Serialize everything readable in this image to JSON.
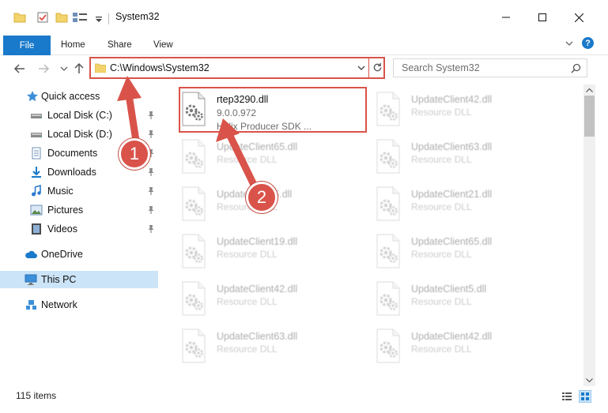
{
  "window": {
    "title": "System32"
  },
  "ribbon": {
    "file": "File",
    "home": "Home",
    "share": "Share",
    "view": "View",
    "help": "?"
  },
  "address": {
    "path": "C:\\Windows\\System32"
  },
  "search": {
    "placeholder": "Search System32"
  },
  "sidebar": {
    "items": [
      {
        "label": "Quick access",
        "icon": "star-icon",
        "pinned": false
      },
      {
        "label": "Local Disk (C:)",
        "icon": "drive-icon",
        "pinned": true
      },
      {
        "label": "Local Disk (D:)",
        "icon": "drive-icon",
        "pinned": true
      },
      {
        "label": "Documents",
        "icon": "documents-icon",
        "pinned": true
      },
      {
        "label": "Downloads",
        "icon": "downloads-icon",
        "pinned": true
      },
      {
        "label": "Music",
        "icon": "music-icon",
        "pinned": true
      },
      {
        "label": "Pictures",
        "icon": "pictures-icon",
        "pinned": true
      },
      {
        "label": "Videos",
        "icon": "videos-icon",
        "pinned": true
      },
      {
        "label": "OneDrive",
        "icon": "cloud-icon",
        "pinned": false
      },
      {
        "label": "This PC",
        "icon": "computer-icon",
        "pinned": false,
        "selected": true
      },
      {
        "label": "Network",
        "icon": "network-icon",
        "pinned": false
      }
    ]
  },
  "files": [
    {
      "name": "rtep3290.dll",
      "line2": "9.0.0.972",
      "line3": "Helix Producer SDK ...",
      "highlighted": true
    },
    {
      "name": "UpdateClient42.dll",
      "line2": "Resource DLL"
    },
    {
      "name": "UpdateClient65.dll",
      "line2": "Resource DLL"
    },
    {
      "name": "UpdateClient63.dll",
      "line2": "Resource DLL"
    },
    {
      "name": "UpdateClient5.dll",
      "line2": "Resource DLL"
    },
    {
      "name": "UpdateClient21.dll",
      "line2": "Resource DLL"
    },
    {
      "name": "UpdateClient19.dll",
      "line2": "Resource DLL"
    },
    {
      "name": "UpdateClient65.dll",
      "line2": "Resource DLL"
    },
    {
      "name": "UpdateClient42.dll",
      "line2": "Resource DLL"
    },
    {
      "name": "UpdateClient5.dll",
      "line2": "Resource DLL"
    },
    {
      "name": "UpdateClient63.dll",
      "line2": "Resource DLL"
    },
    {
      "name": "UpdateClient42.dll",
      "line2": "Resource DLL"
    }
  ],
  "status": {
    "count": "115 items"
  },
  "callouts": {
    "one": "1",
    "two": "2"
  },
  "colors": {
    "accent": "#1979ca",
    "annotation": "#d9534a",
    "selection": "#cce4f7"
  }
}
